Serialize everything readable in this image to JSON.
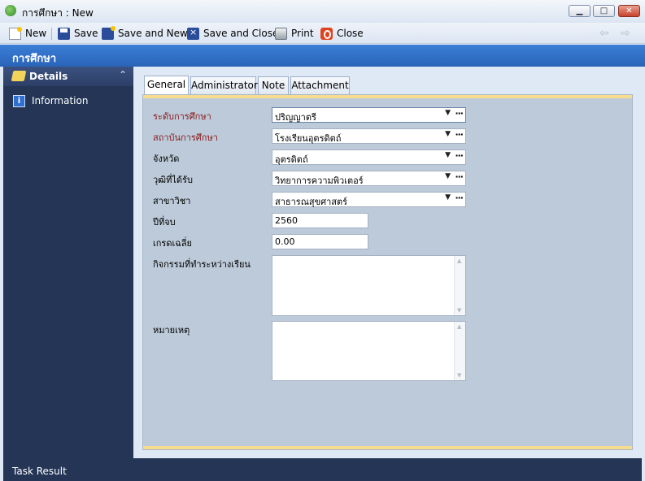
{
  "window": {
    "title": "การศึกษา : New",
    "min_glyph": "▁",
    "max_glyph": "□",
    "close_glyph": "✕"
  },
  "toolbar": {
    "new_label": "New",
    "save_label": "Save",
    "save_new_label": "Save and New",
    "save_close_label": "Save and Close",
    "print_label": "Print",
    "close_label": "Close",
    "back_glyph": "⇦",
    "forward_glyph": "⇨"
  },
  "header": {
    "title": "การศึกษา"
  },
  "sidebar": {
    "section_title": "Details",
    "collapse_glyph": "⌃",
    "items": [
      {
        "label": "Information",
        "icon": "info-icon",
        "icon_glyph": "i"
      }
    ]
  },
  "tabs": [
    {
      "label": "General",
      "active": true
    },
    {
      "label": "Administrator",
      "active": false
    },
    {
      "label": "Note",
      "active": false
    },
    {
      "label": "Attachment",
      "active": false
    }
  ],
  "form": {
    "arrow_glyph": "▼",
    "ellipsis_glyph": "···",
    "level": {
      "label": "ระดับการศึกษา",
      "value": "ปริญญาตรี",
      "required": true
    },
    "institution": {
      "label": "สถาบันการศึกษา",
      "value": "โรงเรียนอุตรดิตถ์",
      "required": true
    },
    "province": {
      "label": "จังหวัด",
      "value": "อุตรดิตถ์"
    },
    "degree": {
      "label": "วุฒิที่ได้รับ",
      "value": "วิทยาการความพิวเตอร์"
    },
    "major": {
      "label": "สาขาวิชา",
      "value": "สาธารณสุขศาสตร์"
    },
    "year": {
      "label": "ปีที่จบ",
      "value": "2560"
    },
    "gpa": {
      "label": "เกรดเฉลี่ย",
      "value": "0.00"
    },
    "activities": {
      "label": "กิจกรรมที่ทำระหว่างเรียน",
      "value": ""
    },
    "remarks": {
      "label": "หมายเหตุ",
      "value": ""
    }
  },
  "status_bar": {
    "text": "Task Result"
  },
  "colors": {
    "header_blue": "#2a64b8",
    "sidebar_navy": "#243556",
    "required_label": "#8b1a1a",
    "tab_accent": "#f6dc8e"
  }
}
